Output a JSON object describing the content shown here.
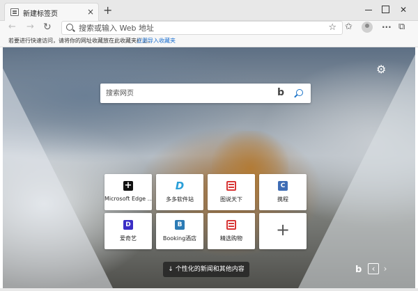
{
  "tab": {
    "title": "新建标签页",
    "close_glyph": "×"
  },
  "new_tab_glyph": "+",
  "window": {
    "close_glyph": "✕"
  },
  "nav": {
    "back_glyph": "←",
    "forward_glyph": "→",
    "refresh_glyph": "↻"
  },
  "address_bar": {
    "placeholder": "搜索或输入 Web 地址",
    "star_glyph": "☆"
  },
  "toolbar": {
    "favorites_glyph": "✩",
    "collections_glyph": "⧉",
    "more_glyph": "···"
  },
  "favorites_bar": {
    "prompt_text": "若要进行快速访问，请将你的网址收藏放在此收藏夹栏上。",
    "import_link": "立即导入收藏夹"
  },
  "settings_glyph": "⚙",
  "search": {
    "placeholder": "搜索网页",
    "bing_glyph": "b"
  },
  "tiles": [
    {
      "label": "Microsoft Edge ...",
      "icon": "edge-plus-icon",
      "glyph": "+"
    },
    {
      "label": "多多软件站",
      "icon": "duoduo-d-icon",
      "glyph": "D"
    },
    {
      "label": "图说天下",
      "icon": "news-icon",
      "glyph": ""
    },
    {
      "label": "携程",
      "icon": "ctrip-c-icon",
      "glyph": "C"
    },
    {
      "label": "爱奇艺",
      "icon": "iqiyi-d-icon",
      "glyph": "D"
    },
    {
      "label": "Booking酒店",
      "icon": "booking-b-icon",
      "glyph": "B"
    },
    {
      "label": "精选购物",
      "icon": "shopping-icon",
      "glyph": ""
    },
    {
      "label": "",
      "icon": "add-icon",
      "glyph": "+"
    }
  ],
  "news_button": {
    "label": "↓ 个性化的新闻和其他内容"
  },
  "carousel": {
    "bing_glyph": "b",
    "prev_glyph": "‹",
    "next_glyph": "›"
  }
}
